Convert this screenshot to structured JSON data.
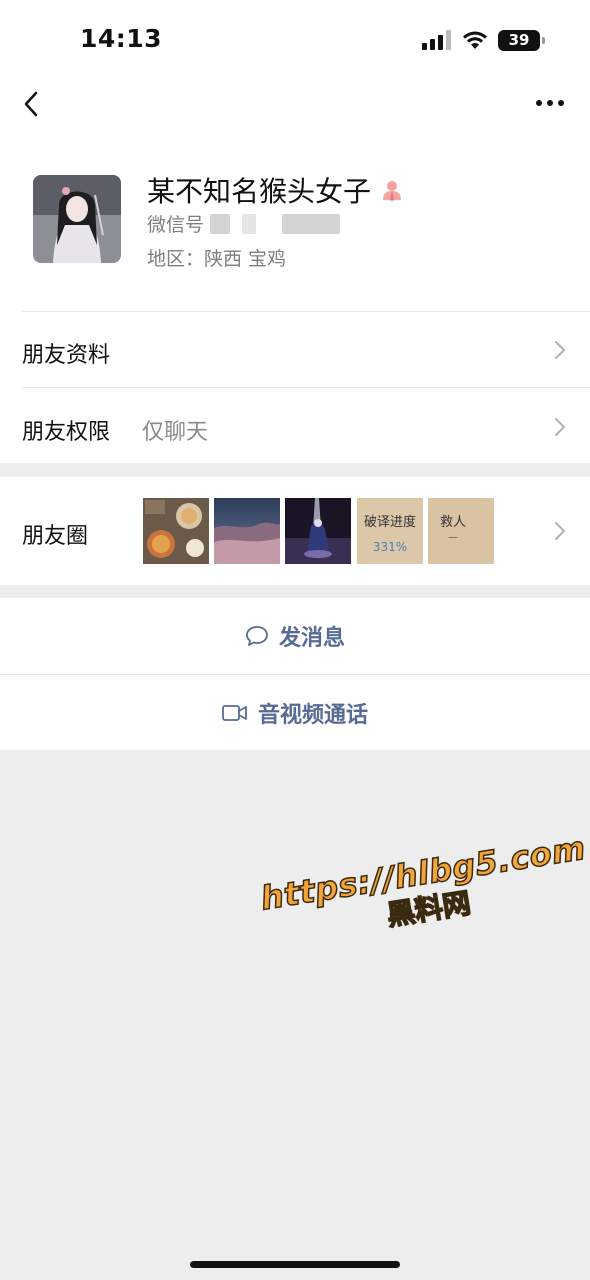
{
  "status_bar": {
    "time": "14:13",
    "battery": "39"
  },
  "profile": {
    "name": "某不知名猴头女子",
    "wechat_id_label": "微信号",
    "region": "地区：陕西 宝鸡"
  },
  "rows": {
    "friend_info": "朋友资料",
    "friend_permission": "朋友权限",
    "friend_permission_value": "仅聊天",
    "moments": "朋友圈"
  },
  "moments_thumbs": [
    {
      "name": "food-photo"
    },
    {
      "name": "sky-photo"
    },
    {
      "name": "night-figure-photo"
    },
    {
      "name": "text-card",
      "text": "破译进度",
      "subtext": "331%"
    },
    {
      "name": "text-card",
      "text": "救人",
      "subtext": "—"
    }
  ],
  "actions": {
    "send_message": "发消息",
    "video_call": "音视频通话"
  },
  "watermark": {
    "line1": "https://hlbg5.com",
    "line2": "黑料网"
  },
  "colors": {
    "link": "#576b95",
    "background": "#ededed",
    "watermark": "#f3a53a"
  }
}
